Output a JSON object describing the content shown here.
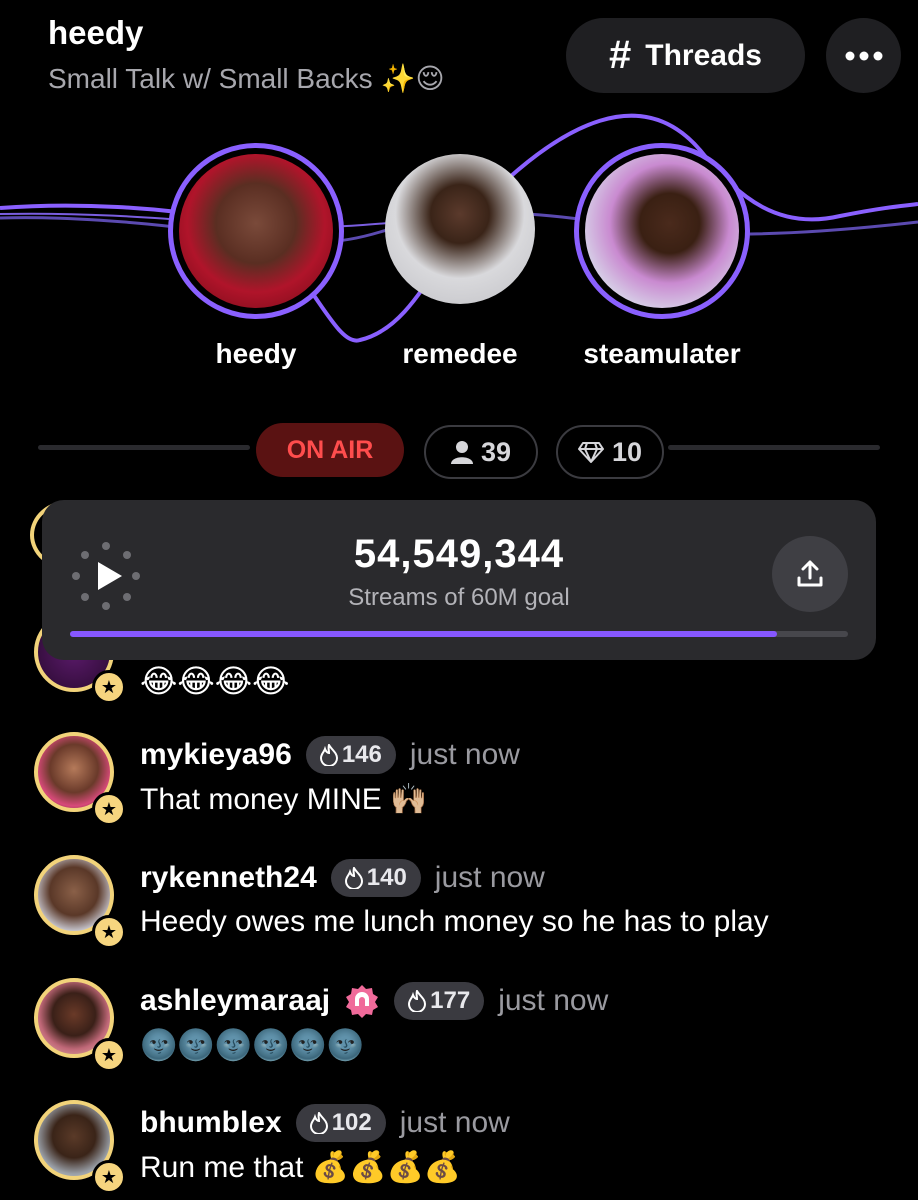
{
  "header": {
    "title": "heedy",
    "subtitle": "Small Talk w/ Small Backs ✨😌",
    "threads_label": "Threads",
    "more_icon": "ellipsis-icon"
  },
  "speakers": [
    {
      "name": "heedy"
    },
    {
      "name": "remedee"
    },
    {
      "name": "steamulater"
    }
  ],
  "stats": {
    "status": "ON AIR",
    "listeners": "39",
    "gems": "10"
  },
  "stream_goal": {
    "count": "54,549,344",
    "label": "Streams of 60M goal",
    "progress": 0.909
  },
  "partial_message": {
    "text": "😂😂😂😂"
  },
  "messages": [
    {
      "user": "mykieya96",
      "score": "146",
      "time": "just now",
      "text": "That money MINE 🙌🏼"
    },
    {
      "user": "rykenneth24",
      "score": "140",
      "time": "just now",
      "text": "Heedy owes me lunch money so he has to play"
    },
    {
      "user": "ashleymaraaj",
      "score": "177",
      "time": "just now",
      "text": "🌚🌚🌚🌚🌚🌚"
    },
    {
      "user": "bhumblex",
      "score": "102",
      "time": "just now",
      "text": "Run me that 💰💰💰💰"
    }
  ],
  "colors": {
    "accent": "#8657ff",
    "on_air_bg": "#5a1212",
    "on_air_text": "#ff4d4d",
    "avatar_ring": "#f2d37a"
  }
}
